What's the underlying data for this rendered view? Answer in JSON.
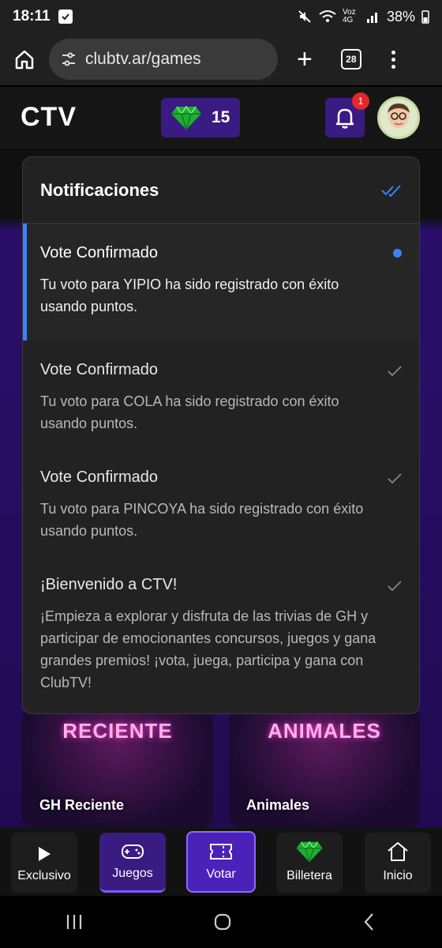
{
  "status_bar": {
    "time": "18:11",
    "network": "Voz 4G",
    "battery": "38%"
  },
  "browser": {
    "url": "clubtv.ar/games",
    "tab_count": "28"
  },
  "header": {
    "logo": "CTV",
    "points": "15",
    "notification_count": "1"
  },
  "notifications": {
    "title": "Notificaciones",
    "items": [
      {
        "title": "Vote Confirmado",
        "body": "Tu voto para YIPIO ha sido registrado con éxito usando puntos.",
        "read": false
      },
      {
        "title": "Vote Confirmado",
        "body": "Tu voto para COLA ha sido registrado con éxito usando puntos.",
        "read": true
      },
      {
        "title": "Vote Confirmado",
        "body": "Tu voto para PINCOYA ha sido registrado con éxito usando puntos.",
        "read": true
      },
      {
        "title": "¡Bienvenido a CTV!",
        "body": "¡Empieza a explorar y disfruta de las trivias de GH y participar de emocionantes concursos, juegos y gana grandes premios! ¡vota, juega, participa y gana con ClubTV!",
        "read": true
      }
    ]
  },
  "games": [
    {
      "art_text": "RECIENTE",
      "label": "GH Reciente"
    },
    {
      "art_text": "ANIMALES",
      "label": "Animales"
    }
  ],
  "bottom_nav": [
    {
      "label": "Exclusivo",
      "icon": "play-icon"
    },
    {
      "label": "Juegos",
      "icon": "gamepad-icon",
      "active": true
    },
    {
      "label": "Votar",
      "icon": "ticket-icon"
    },
    {
      "label": "Billetera",
      "icon": "gem-icon"
    },
    {
      "label": "Inicio",
      "icon": "home-icon"
    }
  ],
  "colors": {
    "accent": "#3a1b82",
    "unread_indicator": "#3b82f6",
    "badge": "#e02828"
  }
}
